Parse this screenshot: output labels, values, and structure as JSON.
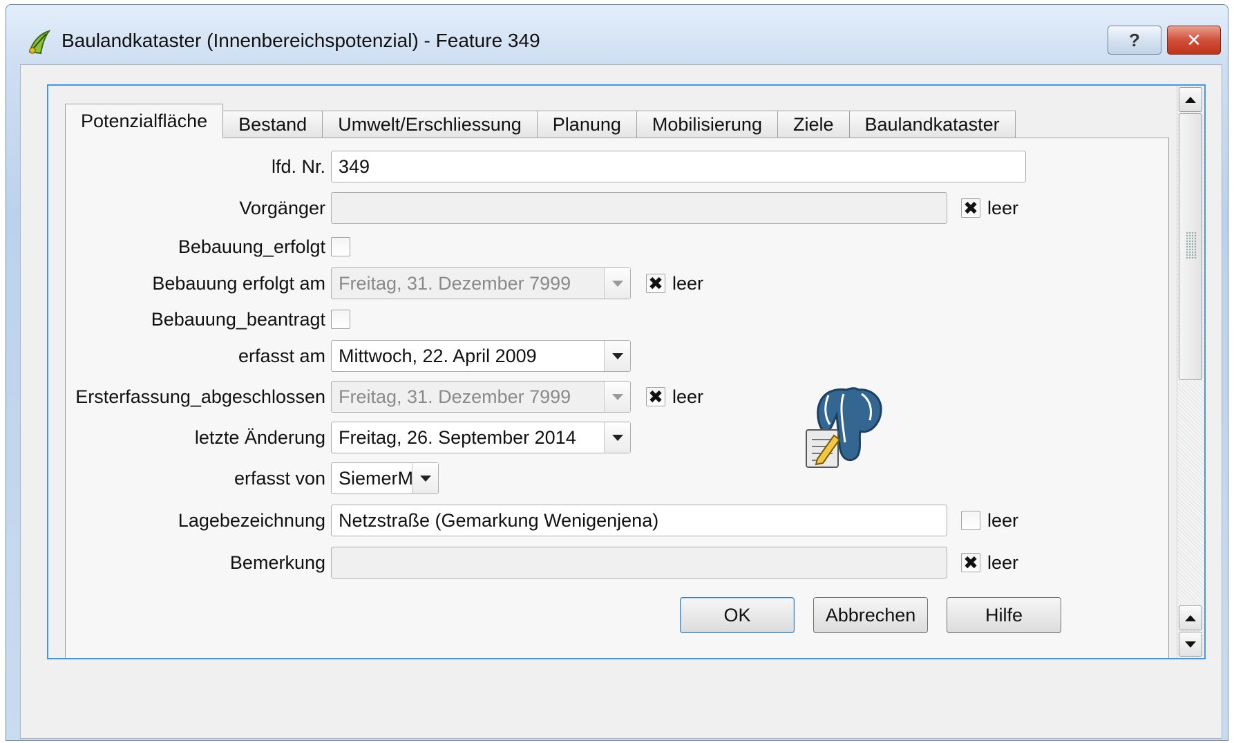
{
  "window": {
    "title": "Baulandkataster (Innenbereichspotenzial) - Feature 349",
    "help_label": "?",
    "close_label": "✕"
  },
  "tabs": [
    {
      "label": "Potenzialfläche",
      "active": true
    },
    {
      "label": "Bestand"
    },
    {
      "label": "Umwelt/Erschliessung"
    },
    {
      "label": "Planung"
    },
    {
      "label": "Mobilisierung"
    },
    {
      "label": "Ziele"
    },
    {
      "label": "Baulandkataster"
    }
  ],
  "form": {
    "lfd_nr": {
      "label": "lfd. Nr.",
      "value": "349"
    },
    "vorgaenger": {
      "label": "Vorgänger",
      "value": "",
      "leer_checked": true
    },
    "bebauung_erfolgt": {
      "label": "Bebauung_erfolgt",
      "checked": false
    },
    "bebauung_erfolgt_am": {
      "label": "Bebauung erfolgt am",
      "value": "Freitag, 31. Dezember 7999",
      "leer_checked": true
    },
    "bebauung_beantragt": {
      "label": "Bebauung_beantragt",
      "checked": false
    },
    "erfasst_am": {
      "label": "erfasst am",
      "value": "Mittwoch, 22. April 2009"
    },
    "ersterfassung_abgeschlossen": {
      "label": "Ersterfassung_abgeschlossen",
      "value": "Freitag, 31. Dezember 7999",
      "leer_checked": true
    },
    "letzte_aenderung": {
      "label": "letzte Änderung",
      "value": "Freitag, 26. September 2014"
    },
    "erfasst_von": {
      "label": "erfasst von",
      "value": "SiemerM"
    },
    "lagebezeichnung": {
      "label": "Lagebezeichnung",
      "value": "Netzstraße (Gemarkung Wenigenjena)",
      "leer_checked": false
    },
    "bemerkung": {
      "label": "Bemerkung",
      "value": "",
      "leer_checked": true
    },
    "leer_label": "leer",
    "checked_mark": "✖"
  },
  "buttons": {
    "ok": "OK",
    "cancel": "Abbrechen",
    "help": "Hilfe"
  },
  "icons": [
    "qgis-app-icon",
    "postgresql-edit-icon",
    "scroll-up-icon",
    "scroll-down-icon",
    "dropdown-arrow-icon"
  ],
  "colors": {
    "focus_border": "#3c9ae8",
    "close_button": "#c03418"
  }
}
